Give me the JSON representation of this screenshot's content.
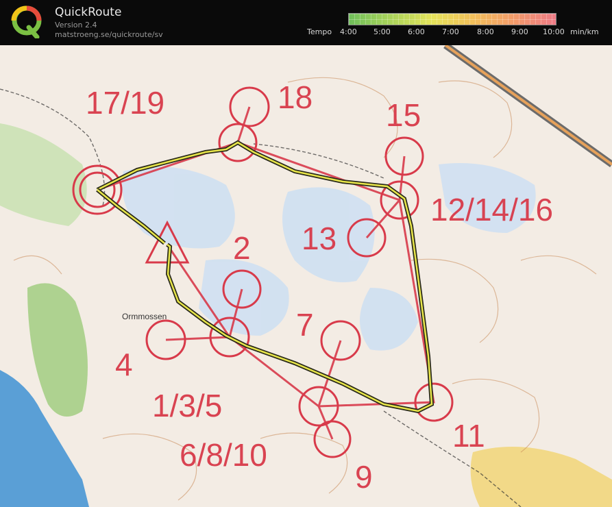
{
  "header": {
    "title": "QuickRoute",
    "version": "Version 2.4",
    "url": "matstroeng.se/quickroute/sv",
    "logo_letter": "Q",
    "tempo_label": "Tempo",
    "tempo_ticks": [
      "4:00",
      "5:00",
      "6:00",
      "7:00",
      "8:00",
      "9:00",
      "10:00"
    ],
    "tempo_unit": "min/km",
    "tempo_colors": [
      "#6fbf5a",
      "#e4e35a",
      "#ee7a86"
    ]
  },
  "map": {
    "place_name": "Ormmossen",
    "control_labels": {
      "c17_19": "17/19",
      "c18": "18",
      "c15": "15",
      "c12_14_16": "12/14/16",
      "c13": "13",
      "c2": "2",
      "c7": "7",
      "c4": "4",
      "c1_3_5": "1/3/5",
      "c6_8_10": "6/8/10",
      "c11": "11",
      "c9": "9"
    },
    "course_color": "#d83a4a",
    "route_color": "#e8e64a"
  }
}
